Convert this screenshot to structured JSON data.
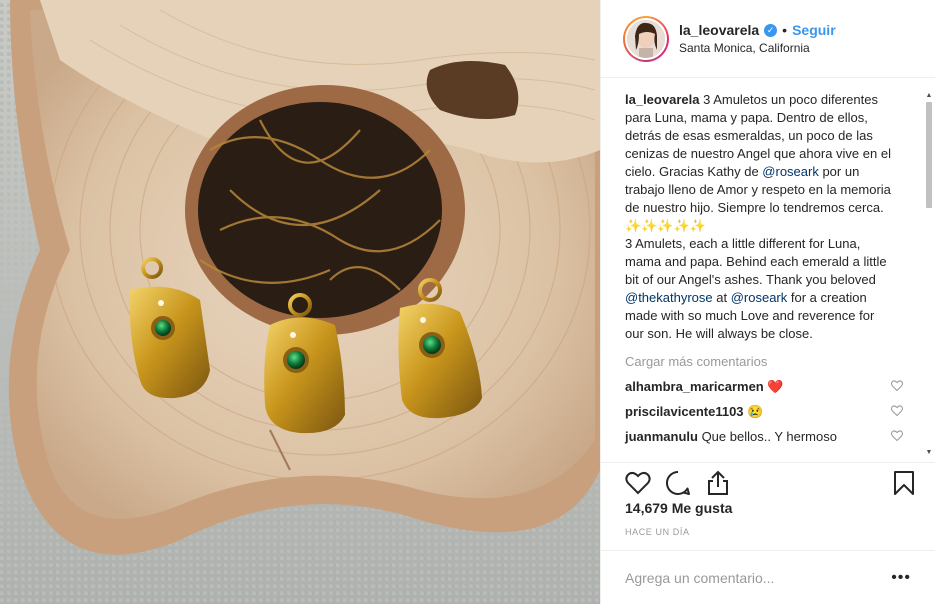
{
  "post": {
    "username": "la_leovarela",
    "follow_label": "Seguir",
    "separator": "•",
    "location": "Santa Monica, California",
    "verified_glyph": "✓"
  },
  "caption": {
    "author": "la_leovarela",
    "spanish_1": " 3 Amuletos un poco diferentes para Luna, mama y papa. Dentro de ellos, detrás de esas esmeraldas, un poco de las cenizas de nuestro Angel que ahora vive en el cielo. Gracias Kathy de ",
    "mention_1": "@roseark",
    "spanish_2": " por un trabajo lleno de Amor y respeto en la memoria de nuestro hijo. Siempre lo tendremos cerca. ",
    "emojis": "✨✨✨✨✨",
    "english_1": "3 Amulets, each a little different for Luna, mama and papa. Behind each emerald a little bit of our Angel's ashes. Thank you beloved ",
    "mention_2": "@thekathyrose",
    "english_2": " at ",
    "mention_3": "@roseark",
    "english_3": " for a creation made with so much Love and reverence for our son. He will always be close."
  },
  "load_more_label": "Cargar más comentarios",
  "comments": [
    {
      "user": "alhambra_maricarmen",
      "text": " ❤️"
    },
    {
      "user": "priscilavicente1103",
      "text": " 😢"
    },
    {
      "user": "juanmanulu",
      "text": " Que bellos.. Y hermoso"
    }
  ],
  "likes_label": "14,679 Me gusta",
  "time_label": "HACE UN DÍA",
  "comment_placeholder": "Agrega un comentario...",
  "more_options": "•••",
  "icons": {
    "like": "heart-icon",
    "comment": "comment-icon",
    "share": "share-icon",
    "save": "bookmark-icon"
  },
  "colors": {
    "link_blue": "#3897f0",
    "mention": "#003569",
    "muted": "#999999",
    "text": "#262626"
  }
}
